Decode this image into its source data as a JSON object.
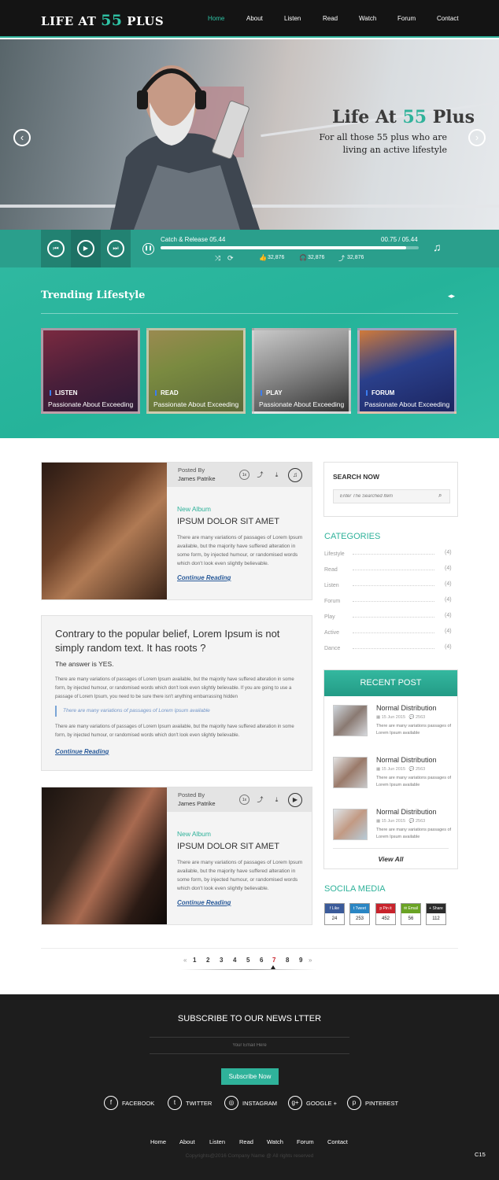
{
  "brand": {
    "logo_pre": "LIFE AT ",
    "logo_num": "55",
    "logo_post": " PLUS"
  },
  "nav": [
    "Home",
    "About",
    "Listen",
    "Read",
    "Watch",
    "Forum",
    "Contact"
  ],
  "hero": {
    "title_pre": "Life At ",
    "title_num": "55",
    "title_post": " Plus",
    "subtitle_line1": "For all those 55 plus who are",
    "subtitle_line2": "living an active lifestyle"
  },
  "player": {
    "track": "Catch &  Release 05.44",
    "time": "00.75 / 05.44",
    "progress": 0.95,
    "likes": "32,876",
    "listens": "32,876",
    "shares": "32,876"
  },
  "trending": {
    "title": "Trending Lifestyle",
    "cards": [
      {
        "label": "LISTEN",
        "subtitle": "Passionate About Exceeding"
      },
      {
        "label": "READ",
        "subtitle": "Passionate About Exceeding"
      },
      {
        "label": "PLAY",
        "subtitle": "Passionate About Exceeding"
      },
      {
        "label": "FORUM",
        "subtitle": "Passionate About Exceeding"
      }
    ]
  },
  "posts": [
    {
      "posted_by_label": "Posted By",
      "author": "James Patrike",
      "category": "New Album",
      "title": "IPSUM DOLOR SIT AMET",
      "excerpt": "There are many variations of passages of Lorem Ipsum available, but the majority have suffered alteration in some form, by injected humour, or randomised words which don't look even slightly believable.",
      "read_more": "Continue Reading",
      "speed": "1x"
    },
    {
      "posted_by_label": "Posted By",
      "author": "James Patrike",
      "category": "New Album",
      "title": "IPSUM DOLOR SIT AMET",
      "excerpt": "There are many variations of passages of Lorem Ipsum available, but the majority have suffered alteration in some form, by injected humour, or randomised words which don't look even slightly believable.",
      "read_more": "Continue Reading",
      "speed": "1x"
    }
  ],
  "article": {
    "heading": "Contrary to the popular belief, Lorem Ipsum is not simply random text. It has roots ?",
    "answer": "The answer is YES.",
    "para1": "There are many variations of passages of Lorem Ipsum available, but the majority have suffered alteration in some form, by injected humour, or randomised words which don't look even slightly believable. If you are going to use a passage of Lorem Ipsum, you need to be sure there isn't anything embarrassing hidden",
    "quote": "There are many variations of passages of Lorem Ipsum available",
    "para2": "There are many variations of passages of Lorem Ipsum available, but the majority have suffered alteration in some form, by injected humour, or randomised words which don't look even slightly believable.",
    "read_more": "Continue Reading"
  },
  "sidebar": {
    "search_title": "SEARCH NOW",
    "search_placeholder": "Enter The Searched Item",
    "categories_title": "CATEGORIES",
    "categories": [
      {
        "name": "Lifestyle",
        "count": "(4)"
      },
      {
        "name": "Read",
        "count": "(4)"
      },
      {
        "name": "Listen",
        "count": "(4)"
      },
      {
        "name": "Forum",
        "count": "(4)"
      },
      {
        "name": "Play",
        "count": "(4)"
      },
      {
        "name": "Active",
        "count": "(4)"
      },
      {
        "name": "Dance",
        "count": "(4)"
      }
    ],
    "recent_title": "RECENT POST",
    "recent": [
      {
        "title": "Normal Distribution",
        "date": "15 Jun 2015",
        "comments": "2563",
        "excerpt": "There are many variations passages of Lorem Ipsum available"
      },
      {
        "title": "Normal Distribution",
        "date": "15 Jun 2015",
        "comments": "2563",
        "excerpt": "There are many variations passages of Lorem Ipsum available"
      },
      {
        "title": "Normal Distribution",
        "date": "15 Jun 2015",
        "comments": "2563",
        "excerpt": "There are many variations passages of Lorem Ipsum available"
      }
    ],
    "view_all": "View All",
    "social_title": "SOCILA MEDIA",
    "social": [
      {
        "label": "Like",
        "count": "24",
        "color": "#3b5b9a"
      },
      {
        "label": "Tweet",
        "count": "253",
        "color": "#2a86c4"
      },
      {
        "label": "Pin it",
        "count": "452",
        "color": "#c8232c"
      },
      {
        "label": "Email",
        "count": "56",
        "color": "#6aa324"
      },
      {
        "label": "Share",
        "count": "112",
        "color": "#2b2b2b"
      }
    ]
  },
  "pagination": {
    "prev": "«",
    "pages": [
      "1",
      "2",
      "3",
      "4",
      "5",
      "6",
      "7",
      "8",
      "9"
    ],
    "current": "7",
    "next": "»"
  },
  "footer": {
    "newsletter_title": "SUBSCRIBE TO OUR NEWS LTTER",
    "email_placeholder": "Your Email Here",
    "subscribe_label": "Subscribe Now",
    "social": [
      "FACEBOOK",
      "TWITTER",
      "INSTAGRAM",
      "GOOGLE +",
      "PINTEREST"
    ],
    "nav": [
      "Home",
      "About",
      "Listen",
      "Read",
      "Watch",
      "Forum",
      "Contact"
    ],
    "copyright": "Copyrights@2016 Company Name @ All rights reserved",
    "code": "C15"
  },
  "colors": {
    "accent": "#2fb29a",
    "dark": "#141414",
    "footer": "#1d1d1d"
  }
}
